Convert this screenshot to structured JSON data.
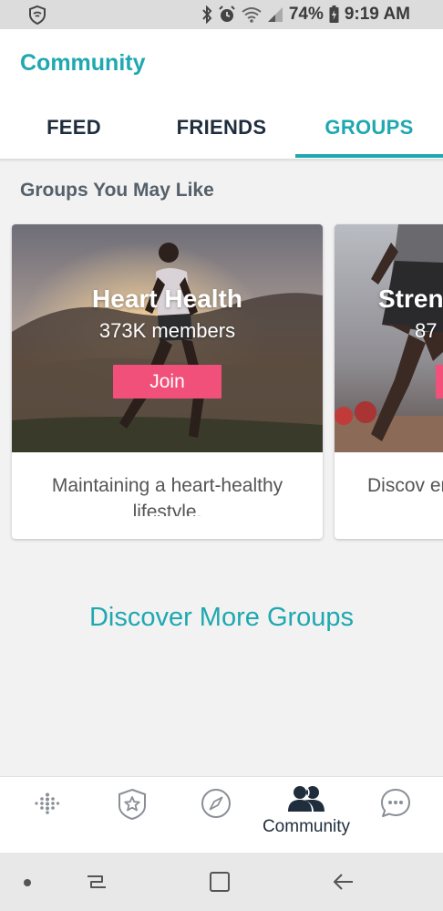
{
  "status_bar": {
    "battery_percent": "74%",
    "time": "9:19 AM",
    "icons": [
      "shield-icon",
      "bluetooth-icon",
      "alarm-icon",
      "wifi-icon",
      "signal-icon",
      "battery-icon"
    ]
  },
  "header": {
    "title": "Community",
    "tabs": [
      {
        "label": "FEED",
        "active": false
      },
      {
        "label": "FRIENDS",
        "active": false
      },
      {
        "label": "GROUPS",
        "active": true
      }
    ]
  },
  "groups": {
    "section_title": "Groups You May Like",
    "cards": [
      {
        "name": "Heart Health",
        "members": "373K members",
        "join_label": "Join",
        "description": "Maintaining a heart-healthy lifestyle."
      },
      {
        "name": "Stren",
        "members": "87",
        "join_label": "",
        "description": "Discov endurar"
      }
    ],
    "discover_more": "Discover More Groups"
  },
  "bottom_nav": {
    "items": [
      {
        "icon": "fitbit-dots-icon",
        "label": ""
      },
      {
        "icon": "badge-star-icon",
        "label": ""
      },
      {
        "icon": "compass-icon",
        "label": ""
      },
      {
        "icon": "community-people-icon",
        "label": "Community",
        "active": true
      },
      {
        "icon": "chat-bubble-icon",
        "label": ""
      }
    ]
  },
  "colors": {
    "accent": "#1fa8b0",
    "join_button": "#f0507a",
    "dark_text": "#1f2d3d"
  }
}
